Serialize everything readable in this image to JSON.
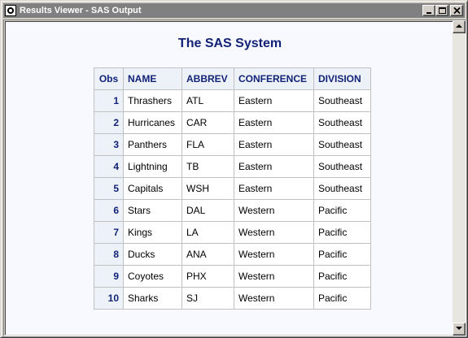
{
  "window": {
    "title": "Results Viewer - SAS Output",
    "icon": "sas-results-icon",
    "buttons": [
      "minimize-icon",
      "maximize-icon",
      "close-icon"
    ]
  },
  "report": {
    "title": "The SAS System",
    "columns": [
      "Obs",
      "NAME",
      "ABBREV",
      "CONFERENCE",
      "DIVISION"
    ],
    "rows": [
      [
        "1",
        "Thrashers",
        "ATL",
        "Eastern",
        "Southeast"
      ],
      [
        "2",
        "Hurricanes",
        "CAR",
        "Eastern",
        "Southeast"
      ],
      [
        "3",
        "Panthers",
        "FLA",
        "Eastern",
        "Southeast"
      ],
      [
        "4",
        "Lightning",
        "TB",
        "Eastern",
        "Southeast"
      ],
      [
        "5",
        "Capitals",
        "WSH",
        "Eastern",
        "Southeast"
      ],
      [
        "6",
        "Stars",
        "DAL",
        "Western",
        "Pacific"
      ],
      [
        "7",
        "Kings",
        "LA",
        "Western",
        "Pacific"
      ],
      [
        "8",
        "Ducks",
        "ANA",
        "Western",
        "Pacific"
      ],
      [
        "9",
        "Coyotes",
        "PHX",
        "Western",
        "Pacific"
      ],
      [
        "10",
        "Sharks",
        "SJ",
        "Western",
        "Pacific"
      ]
    ]
  },
  "colors": {
    "title_text": "#112277",
    "header_bg": "#edf2f9",
    "page_bg": "#f8f8ff",
    "titlebar_bg": "#808080"
  }
}
